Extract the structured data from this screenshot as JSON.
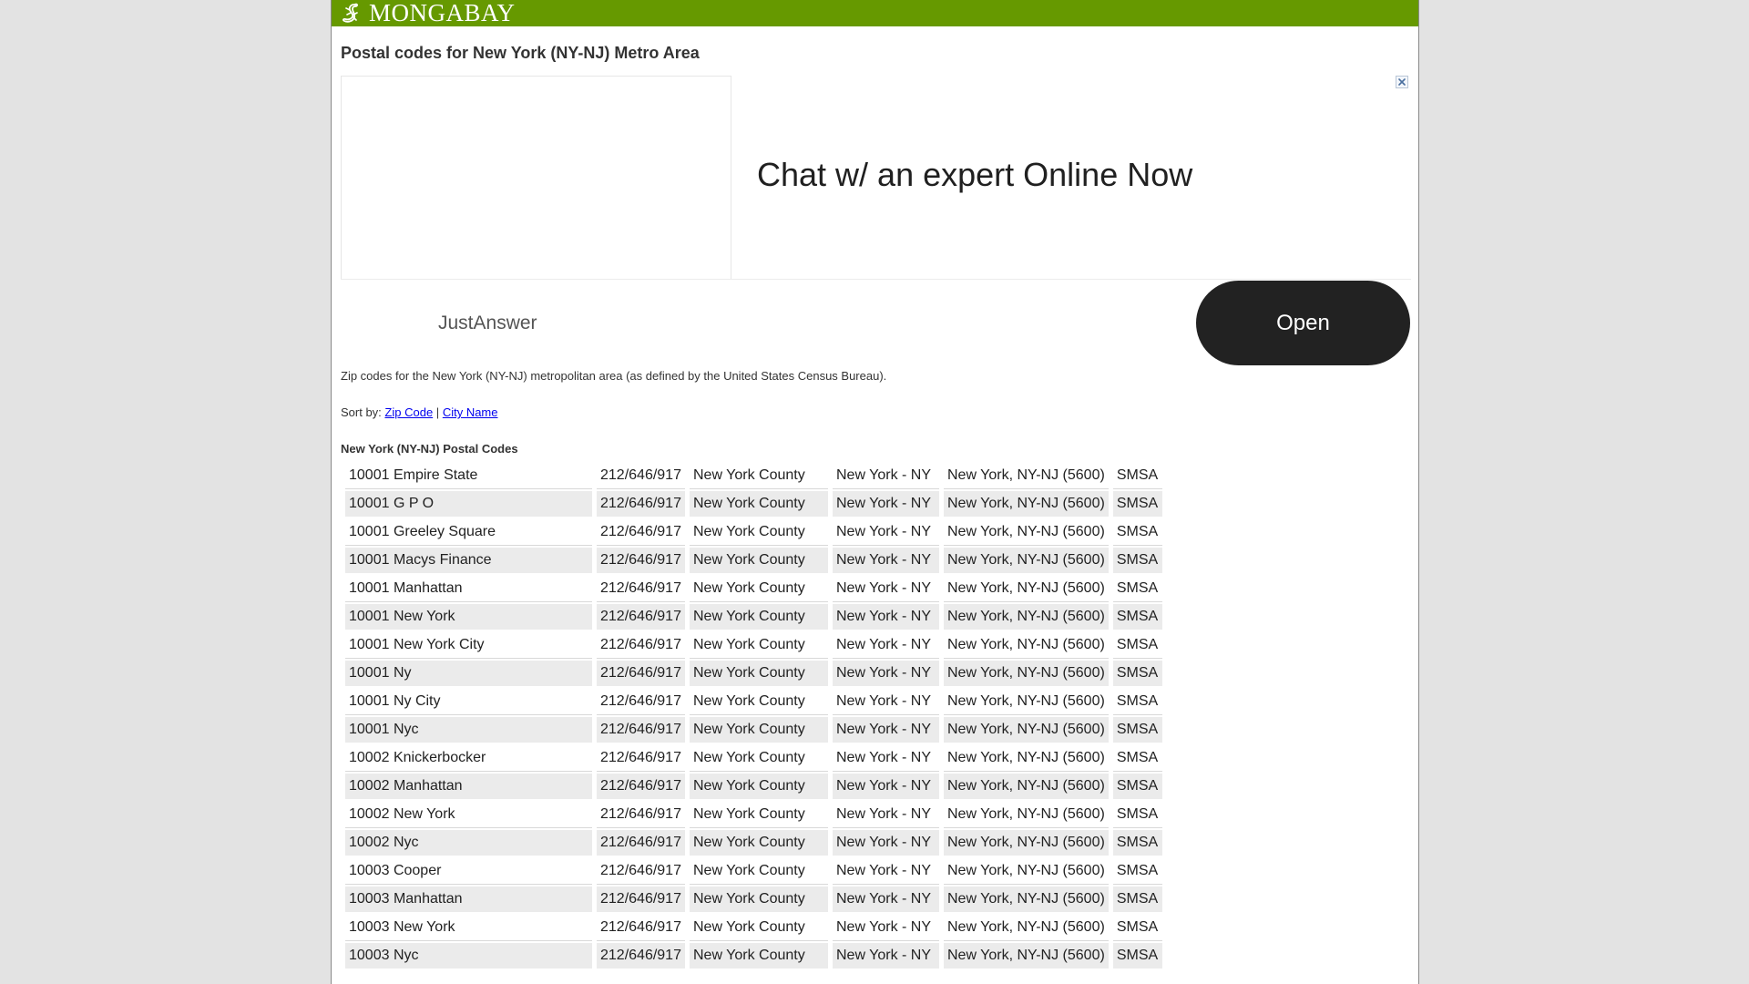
{
  "brand": {
    "name": "MONGABAY",
    "color": "#669900",
    "icon": "gecko-icon"
  },
  "page": {
    "title": "Postal codes for New York (NY-NJ) Metro Area"
  },
  "ad": {
    "headline": "Chat w/ an expert Online Now",
    "sponsor": "JustAnswer",
    "button_label": "Open",
    "close_icon": "close-icon"
  },
  "description": "Zip codes for the New York (NY-NJ) metropolitan area (as defined by the United States Census Bureau).",
  "sort": {
    "label": "Sort by:",
    "separator": "|",
    "options": [
      "Zip Code",
      "City Name"
    ]
  },
  "table": {
    "caption": "New York (NY-NJ) Postal Codes",
    "rows": [
      [
        "10001 Empire State",
        "212/646/917",
        "New York County",
        "New York - NY",
        "New York, NY-NJ (5600)",
        "SMSA"
      ],
      [
        "10001 G P O",
        "212/646/917",
        "New York County",
        "New York - NY",
        "New York, NY-NJ (5600)",
        "SMSA"
      ],
      [
        "10001 Greeley Square",
        "212/646/917",
        "New York County",
        "New York - NY",
        "New York, NY-NJ (5600)",
        "SMSA"
      ],
      [
        "10001 Macys Finance",
        "212/646/917",
        "New York County",
        "New York - NY",
        "New York, NY-NJ (5600)",
        "SMSA"
      ],
      [
        "10001 Manhattan",
        "212/646/917",
        "New York County",
        "New York - NY",
        "New York, NY-NJ (5600)",
        "SMSA"
      ],
      [
        "10001 New York",
        "212/646/917",
        "New York County",
        "New York - NY",
        "New York, NY-NJ (5600)",
        "SMSA"
      ],
      [
        "10001 New York City",
        "212/646/917",
        "New York County",
        "New York - NY",
        "New York, NY-NJ (5600)",
        "SMSA"
      ],
      [
        "10001 Ny",
        "212/646/917",
        "New York County",
        "New York - NY",
        "New York, NY-NJ (5600)",
        "SMSA"
      ],
      [
        "10001 Ny City",
        "212/646/917",
        "New York County",
        "New York - NY",
        "New York, NY-NJ (5600)",
        "SMSA"
      ],
      [
        "10001 Nyc",
        "212/646/917",
        "New York County",
        "New York - NY",
        "New York, NY-NJ (5600)",
        "SMSA"
      ],
      [
        "10002 Knickerbocker",
        "212/646/917",
        "New York County",
        "New York - NY",
        "New York, NY-NJ (5600)",
        "SMSA"
      ],
      [
        "10002 Manhattan",
        "212/646/917",
        "New York County",
        "New York - NY",
        "New York, NY-NJ (5600)",
        "SMSA"
      ],
      [
        "10002 New York",
        "212/646/917",
        "New York County",
        "New York - NY",
        "New York, NY-NJ (5600)",
        "SMSA"
      ],
      [
        "10002 Nyc",
        "212/646/917",
        "New York County",
        "New York - NY",
        "New York, NY-NJ (5600)",
        "SMSA"
      ],
      [
        "10003 Cooper",
        "212/646/917",
        "New York County",
        "New York - NY",
        "New York, NY-NJ (5600)",
        "SMSA"
      ],
      [
        "10003 Manhattan",
        "212/646/917",
        "New York County",
        "New York - NY",
        "New York, NY-NJ (5600)",
        "SMSA"
      ],
      [
        "10003 New York",
        "212/646/917",
        "New York County",
        "New York - NY",
        "New York, NY-NJ (5600)",
        "SMSA"
      ],
      [
        "10003 Nyc",
        "212/646/917",
        "New York County",
        "New York - NY",
        "New York, NY-NJ (5600)",
        "SMSA"
      ]
    ]
  }
}
